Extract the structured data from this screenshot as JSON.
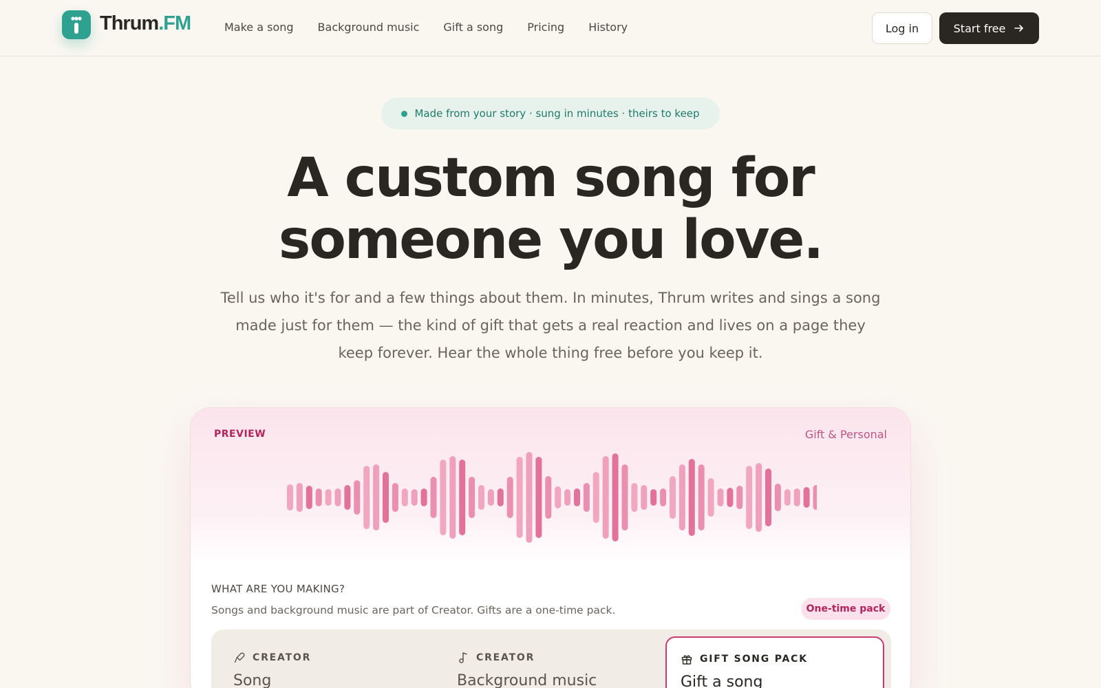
{
  "brand": {
    "name_main": "Thrum",
    "name_accent": ".FM",
    "teal": "#2fa191",
    "dark": "#2a2622",
    "pink": "#b3245c"
  },
  "nav": {
    "links": [
      "Make a song",
      "Background music",
      "Gift a song",
      "Pricing",
      "History"
    ],
    "login_label": "Log in",
    "start_label": "Start free"
  },
  "hero": {
    "pill_text": "Made from your story · sung in minutes · theirs to keep",
    "title_line1": "A custom song for",
    "title_line2": "someone you love.",
    "subtitle": "Tell us who it's for and a few things about them. In minutes, Thrum writes and sings a song made just for them — the kind of gift that gets a real reaction and lives on a page they keep forever. Hear the whole thing free before you keep it."
  },
  "card": {
    "preview_label": "PREVIEW",
    "category_label": "Gift & Personal",
    "making_title": "WHAT ARE YOU MAKING?",
    "making_desc": "Songs and background music are part of Creator. Gifts are a one-time pack.",
    "onetime_badge": "One-time pack",
    "options": [
      {
        "tag": "CREATOR",
        "name": "Song",
        "icon": "microphone-icon"
      },
      {
        "tag": "CREATOR",
        "name": "Background music",
        "icon": "music-note-icon"
      },
      {
        "tag": "GIFT SONG PACK",
        "name": "Gift a song",
        "icon": "gift-icon",
        "selected": true
      }
    ]
  }
}
